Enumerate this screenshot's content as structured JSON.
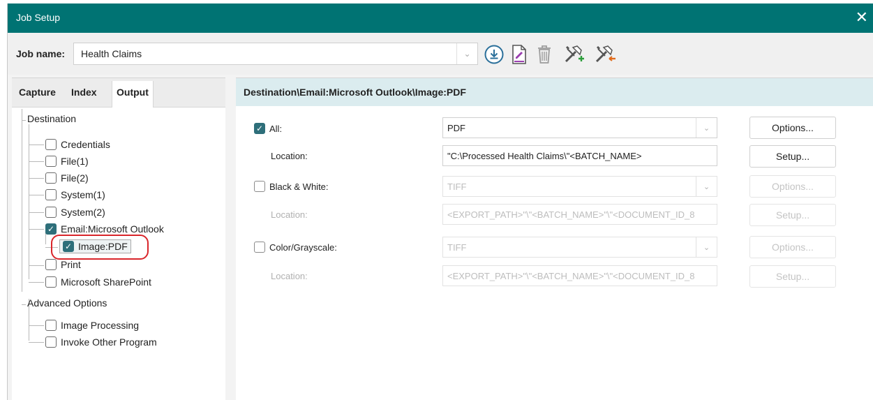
{
  "window": {
    "title": "Job Setup",
    "close_glyph": "✕"
  },
  "job": {
    "label": "Job name:",
    "value": "Health Claims",
    "dropdown_glyph": "⌄"
  },
  "toolbar": {
    "icons": [
      "download-icon",
      "edit-document-icon",
      "delete-icon",
      "tools-add-icon",
      "tools-remove-icon"
    ]
  },
  "tabs": [
    "Capture",
    "Index",
    "Output"
  ],
  "active_tab": "Output",
  "tree": {
    "destination": "Destination",
    "items": [
      {
        "label": "Credentials",
        "checked": false
      },
      {
        "label": "File(1)",
        "checked": false
      },
      {
        "label": "File(2)",
        "checked": false
      },
      {
        "label": "System(1)",
        "checked": false
      },
      {
        "label": "System(2)",
        "checked": false
      },
      {
        "label": "Email:Microsoft Outlook",
        "checked": true
      },
      {
        "label": "Image:PDF",
        "checked": true
      },
      {
        "label": "Print",
        "checked": false
      },
      {
        "label": "Microsoft SharePoint",
        "checked": false
      }
    ],
    "advanced": "Advanced Options",
    "advanced_items": [
      {
        "label": "Image Processing",
        "checked": false
      },
      {
        "label": "Invoke Other Program",
        "checked": false
      }
    ]
  },
  "path_header": "Destination\\Email:Microsoft Outlook\\Image:PDF",
  "rows": {
    "all": {
      "label": "All:",
      "checked": true,
      "format": "PDF",
      "button": "Options..."
    },
    "all_location": {
      "label": "Location:",
      "value": "\"C:\\Processed Health Claims\\\"<BATCH_NAME>",
      "button": "Setup..."
    },
    "bw": {
      "label": "Black & White:",
      "checked": false,
      "format": "TIFF",
      "button": "Options..."
    },
    "bw_location": {
      "label": "Location:",
      "value": "<EXPORT_PATH>\"\\\"<BATCH_NAME>\"\\\"<DOCUMENT_ID_8",
      "button": "Setup..."
    },
    "color": {
      "label": "Color/Grayscale:",
      "checked": false,
      "format": "TIFF",
      "button": "Options..."
    },
    "color_location": {
      "label": "Location:",
      "value": "<EXPORT_PATH>\"\\\"<BATCH_NAME>\"\\\"<DOCUMENT_ID_8",
      "button": "Setup..."
    }
  },
  "colors": {
    "titlebar": "#007373",
    "header_bg": "#dbecef",
    "checkbox": "#2e6f7a",
    "highlight": "#d9252a"
  }
}
